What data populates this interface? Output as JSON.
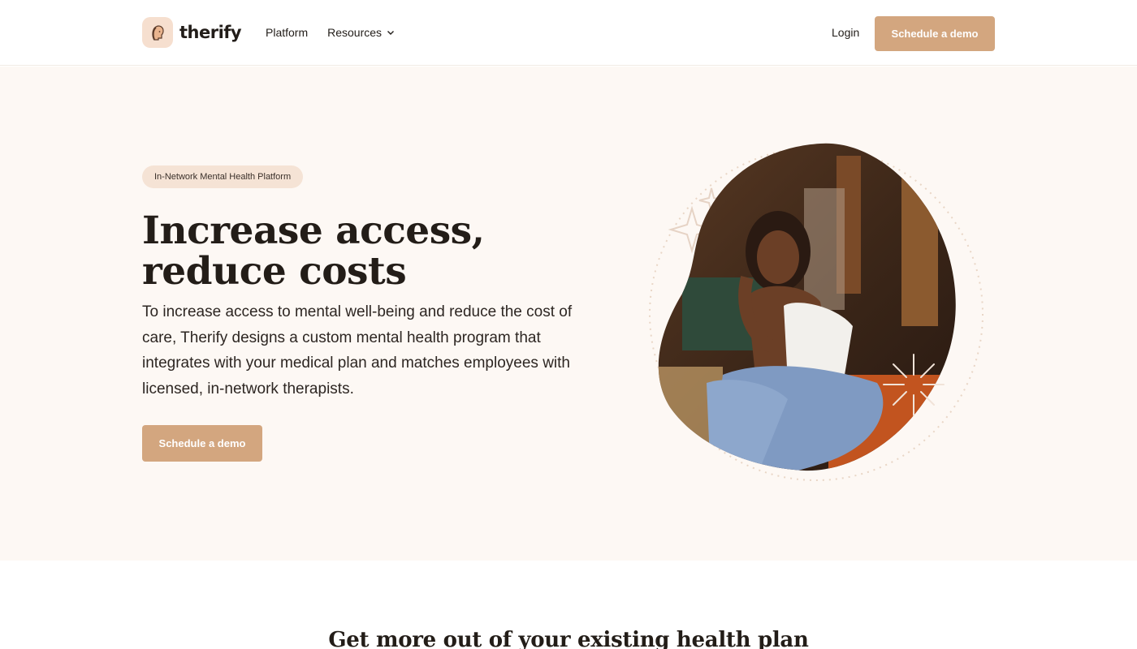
{
  "header": {
    "brand": "therify",
    "nav": [
      {
        "label": "Platform"
      },
      {
        "label": "Resources"
      }
    ],
    "login_label": "Login",
    "cta_label": "Schedule a demo"
  },
  "hero": {
    "badge": "In-Network Mental Health Platform",
    "title_line1": "Increase access,",
    "title_line2": "reduce costs",
    "body": "To increase access to mental well-being and reduce the cost of care, Therify designs a custom mental health program that integrates with your medical plan and matches employees with licensed, in-network therapists.",
    "cta_label": "Schedule a demo"
  },
  "section": {
    "title": "Get more out of your existing health plan"
  },
  "colors": {
    "accent": "#d3a67f",
    "hero_bg": "#fdf8f4",
    "badge_bg": "#f5e3d5"
  }
}
